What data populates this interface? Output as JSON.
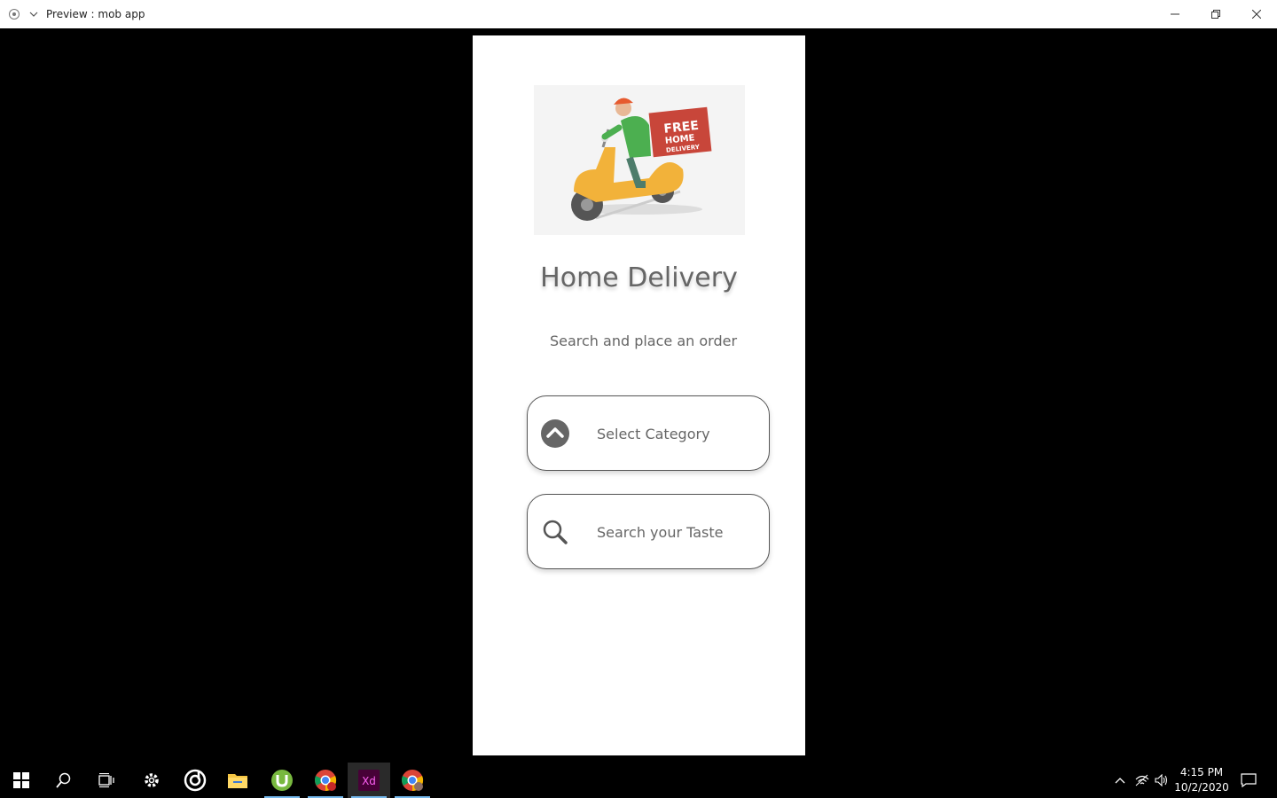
{
  "window": {
    "title": "Preview : mob app",
    "controls": [
      "minimize-icon",
      "restore-icon",
      "close-icon"
    ]
  },
  "app": {
    "hero_image": {
      "sign_lines": [
        "FREE",
        "HOME",
        "DELIVERY"
      ]
    },
    "title": "Home Delivery",
    "subtitle": "Search and place an order",
    "category_button": {
      "label": "Select Category",
      "icon": "chevron-up-circle-icon"
    },
    "search_button": {
      "label": "Search your Taste",
      "icon": "search-icon"
    }
  },
  "taskbar": {
    "items": [
      "windows-start-icon",
      "search-icon",
      "task-view-icon",
      "settings-icon",
      "groove-music-icon",
      "file-explorer-icon",
      "utorrent-icon",
      "chrome-icon",
      "adobe-xd-icon",
      "chrome-profile-icon"
    ],
    "xd_label": "Xd",
    "clock": {
      "time": "4:15 PM",
      "date": "10/2/2020"
    }
  },
  "colors": {
    "text_gray": "#666666",
    "xd_bg": "#470137",
    "xd_text": "#ff61f6",
    "scooter": "#f2b23a",
    "box": "#c8463a",
    "active_indicator": "#76b9ed"
  }
}
